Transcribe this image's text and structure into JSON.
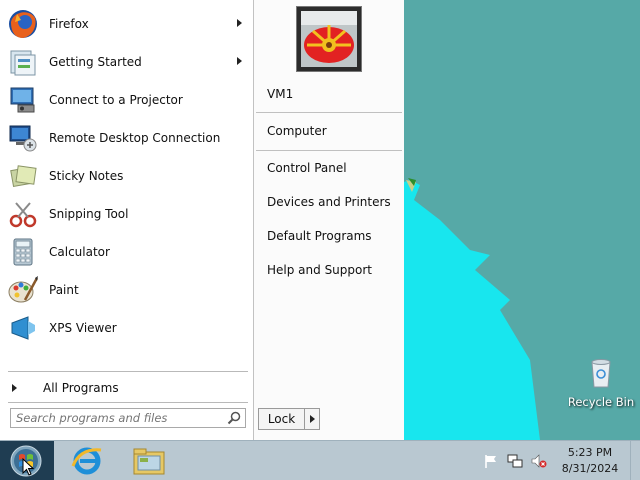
{
  "start_menu": {
    "programs": [
      {
        "label": "Firefox",
        "icon": "firefox-icon",
        "has_submenu": true
      },
      {
        "label": "Getting Started",
        "icon": "getting-started-icon",
        "has_submenu": true
      },
      {
        "label": "Connect to a Projector",
        "icon": "projector-icon",
        "has_submenu": false
      },
      {
        "label": "Remote Desktop Connection",
        "icon": "remote-desktop-icon",
        "has_submenu": false
      },
      {
        "label": "Sticky Notes",
        "icon": "sticky-notes-icon",
        "has_submenu": false
      },
      {
        "label": "Snipping Tool",
        "icon": "snipping-tool-icon",
        "has_submenu": false
      },
      {
        "label": "Calculator",
        "icon": "calculator-icon",
        "has_submenu": false
      },
      {
        "label": "Paint",
        "icon": "paint-icon",
        "has_submenu": false
      },
      {
        "label": "XPS Viewer",
        "icon": "xps-viewer-icon",
        "has_submenu": false
      }
    ],
    "all_programs": "All Programs",
    "search_placeholder": "Search programs and files",
    "right_links": {
      "user": "VM1",
      "computer": "Computer",
      "control_panel": "Control Panel",
      "devices": "Devices and Printers",
      "default_programs": "Default Programs",
      "help": "Help and Support"
    },
    "lock_label": "Lock"
  },
  "desktop": {
    "recycle_bin": "Recycle Bin"
  },
  "taskbar": {
    "pinned": [
      "internet-explorer-icon",
      "file-explorer-icon"
    ],
    "tray_icons": [
      "action-center-flag-icon",
      "network-icon",
      "volume-muted-icon"
    ],
    "time": "5:23 PM",
    "date": "8/31/2024"
  },
  "colors": {
    "desktop": "#56a9a7",
    "taskbar": "#b9c8d1",
    "start_button": "#1f3d52"
  }
}
